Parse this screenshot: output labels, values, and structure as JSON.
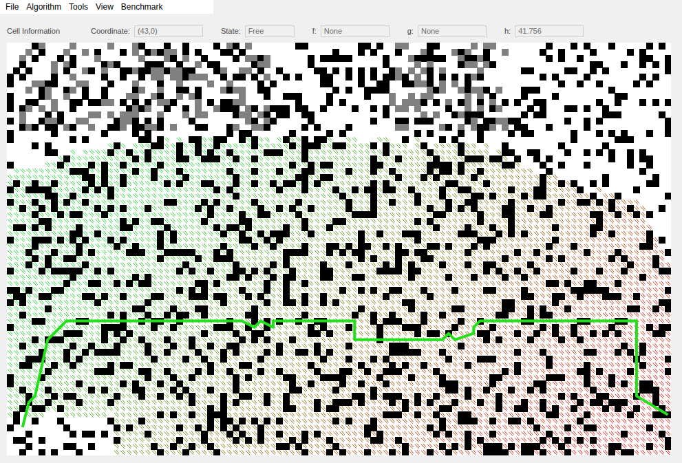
{
  "menu": [
    {
      "label": "File"
    },
    {
      "label": "Algorithm"
    },
    {
      "label": "Tools"
    },
    {
      "label": "View"
    },
    {
      "label": "Benchmark"
    }
  ],
  "cell_info": {
    "title": "Cell Information",
    "fields": [
      {
        "label": "Coordinate:",
        "value": "(43,0)"
      },
      {
        "label": "State:",
        "value": "Free"
      },
      {
        "label": "f:",
        "value": "None"
      },
      {
        "label": "g:",
        "value": "None"
      },
      {
        "label": "h:",
        "value": "41.756"
      }
    ]
  },
  "grid": {
    "columns": 106,
    "rows": 66,
    "path": [
      [
        2,
        61
      ],
      [
        3,
        57
      ],
      [
        4,
        56
      ],
      [
        6,
        47
      ],
      [
        9,
        44
      ],
      [
        37,
        44
      ],
      [
        39,
        45
      ],
      [
        40,
        44
      ],
      [
        42,
        45
      ],
      [
        42,
        44
      ],
      [
        55,
        44
      ],
      [
        55,
        47
      ],
      [
        69,
        47
      ],
      [
        70,
        46
      ],
      [
        71,
        47
      ],
      [
        74,
        46
      ],
      [
        74,
        45
      ],
      [
        75,
        44
      ],
      [
        100,
        44
      ],
      [
        100,
        56
      ],
      [
        105,
        59
      ]
    ]
  }
}
